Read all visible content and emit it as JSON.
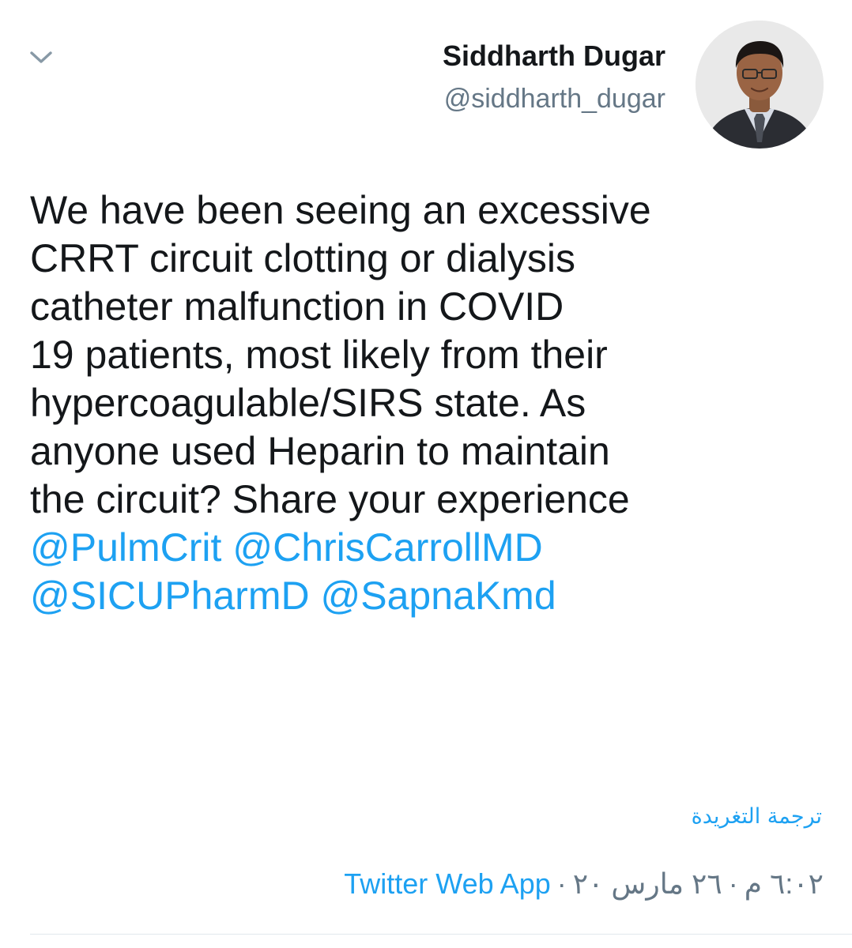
{
  "author": {
    "display_name": "Siddharth Dugar",
    "handle": "@siddharth_dugar"
  },
  "icons": {
    "menu": "chevron-down-icon",
    "avatar": "profile-photo"
  },
  "tweet": {
    "lines": [
      "We have been seeing an excessive",
      "CRRT circuit clotting or dialysis",
      "catheter malfunction in COVID",
      "19 patients, most likely from their",
      "hypercoagulable/SIRS state. As",
      "anyone used Heparin to maintain",
      "the circuit? Share your experience"
    ],
    "mentions": [
      "@PulmCrit",
      "@ChrisCarrollMD",
      "@SICUPharmD",
      "@SapnaKmd"
    ]
  },
  "translate_label": "ترجمة التغريدة",
  "meta": {
    "time": "٦:٠٢ م",
    "date": "٢٦ مارس ٢٠",
    "separator": "·",
    "source": "Twitter Web App"
  },
  "colors": {
    "link": "#1da1f2",
    "secondary_text": "#657786",
    "primary_text": "#14171a",
    "divider": "#e1e8ed"
  }
}
